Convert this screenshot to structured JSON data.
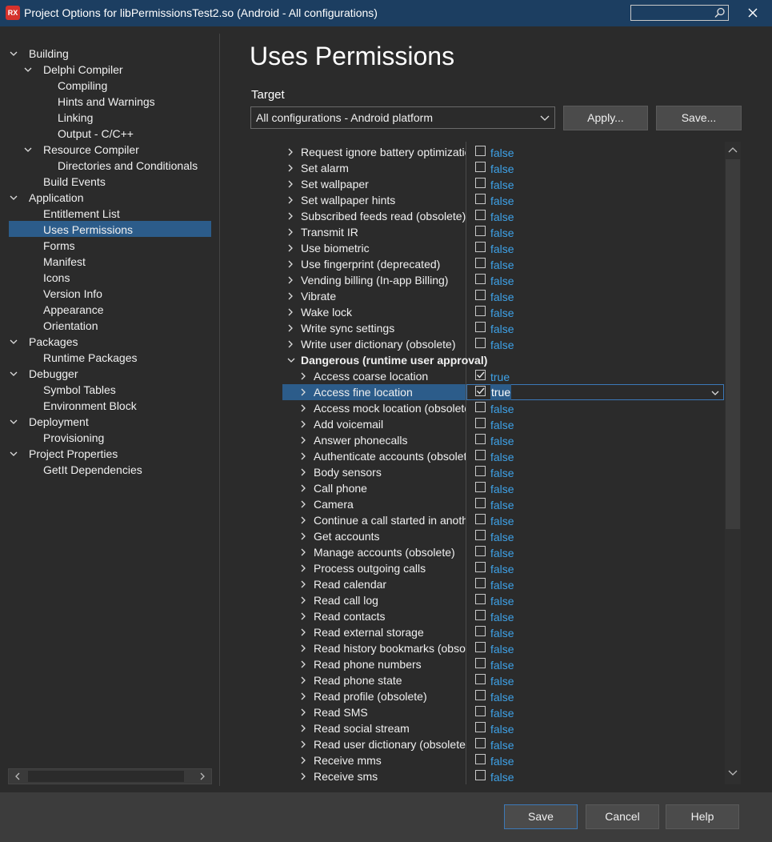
{
  "window": {
    "title": "Project Options for libPermissionsTest2.so  (Android - All configurations)",
    "logo_text": "RX",
    "search_placeholder": ""
  },
  "tree": [
    {
      "label": "Building",
      "level": 0,
      "expanded": true
    },
    {
      "label": "Delphi Compiler",
      "level": 1,
      "expanded": true
    },
    {
      "label": "Compiling",
      "level": 2
    },
    {
      "label": "Hints and Warnings",
      "level": 2
    },
    {
      "label": "Linking",
      "level": 2
    },
    {
      "label": "Output - C/C++",
      "level": 2
    },
    {
      "label": "Resource Compiler",
      "level": 1,
      "expanded": true
    },
    {
      "label": "Directories and Conditionals",
      "level": 2
    },
    {
      "label": "Build Events",
      "level": 1
    },
    {
      "label": "Application",
      "level": 0,
      "expanded": true
    },
    {
      "label": "Entitlement List",
      "level": 1
    },
    {
      "label": "Uses Permissions",
      "level": 1,
      "selected": true
    },
    {
      "label": "Forms",
      "level": 1
    },
    {
      "label": "Manifest",
      "level": 1
    },
    {
      "label": "Icons",
      "level": 1
    },
    {
      "label": "Version Info",
      "level": 1
    },
    {
      "label": "Appearance",
      "level": 1
    },
    {
      "label": "Orientation",
      "level": 1
    },
    {
      "label": "Packages",
      "level": 0,
      "expanded": true
    },
    {
      "label": "Runtime Packages",
      "level": 1
    },
    {
      "label": "Debugger",
      "level": 0,
      "expanded": true
    },
    {
      "label": "Symbol Tables",
      "level": 1
    },
    {
      "label": "Environment Block",
      "level": 1
    },
    {
      "label": "Deployment",
      "level": 0,
      "expanded": true
    },
    {
      "label": "Provisioning",
      "level": 1
    },
    {
      "label": "Project Properties",
      "level": 0,
      "expanded": true
    },
    {
      "label": "GetIt Dependencies",
      "level": 1
    }
  ],
  "main": {
    "title": "Uses Permissions",
    "target_label": "Target",
    "target_value": "All configurations - Android platform",
    "apply_label": "Apply...",
    "save_label": "Save..."
  },
  "permissions": [
    {
      "name": "Request ignore battery optimizations",
      "value": "false",
      "checked": false,
      "indent": 1
    },
    {
      "name": "Set alarm",
      "value": "false",
      "checked": false,
      "indent": 1
    },
    {
      "name": "Set wallpaper",
      "value": "false",
      "checked": false,
      "indent": 1
    },
    {
      "name": "Set wallpaper hints",
      "value": "false",
      "checked": false,
      "indent": 1
    },
    {
      "name": "Subscribed feeds read (obsolete)",
      "value": "false",
      "checked": false,
      "indent": 1
    },
    {
      "name": "Transmit IR",
      "value": "false",
      "checked": false,
      "indent": 1
    },
    {
      "name": "Use biometric",
      "value": "false",
      "checked": false,
      "indent": 1
    },
    {
      "name": "Use fingerprint (deprecated)",
      "value": "false",
      "checked": false,
      "indent": 1
    },
    {
      "name": "Vending billing (In-app Billing)",
      "value": "false",
      "checked": false,
      "indent": 1
    },
    {
      "name": "Vibrate",
      "value": "false",
      "checked": false,
      "indent": 1
    },
    {
      "name": "Wake lock",
      "value": "false",
      "checked": false,
      "indent": 1
    },
    {
      "name": "Write sync settings",
      "value": "false",
      "checked": false,
      "indent": 1
    },
    {
      "name": "Write user dictionary (obsolete)",
      "value": "false",
      "checked": false,
      "indent": 1
    },
    {
      "name": "Dangerous (runtime user approval)",
      "category": true
    },
    {
      "name": "Access coarse location",
      "value": "true",
      "checked": true,
      "indent": 2
    },
    {
      "name": "Access fine location",
      "value": "true",
      "checked": true,
      "indent": 2,
      "selected": true
    },
    {
      "name": "Access mock location (obsolete)",
      "value": "false",
      "checked": false,
      "indent": 2
    },
    {
      "name": "Add voicemail",
      "value": "false",
      "checked": false,
      "indent": 2
    },
    {
      "name": "Answer phonecalls",
      "value": "false",
      "checked": false,
      "indent": 2
    },
    {
      "name": "Authenticate accounts (obsolete)",
      "value": "false",
      "checked": false,
      "indent": 2
    },
    {
      "name": "Body sensors",
      "value": "false",
      "checked": false,
      "indent": 2
    },
    {
      "name": "Call phone",
      "value": "false",
      "checked": false,
      "indent": 2
    },
    {
      "name": "Camera",
      "value": "false",
      "checked": false,
      "indent": 2
    },
    {
      "name": "Continue a call started in another app",
      "value": "false",
      "checked": false,
      "indent": 2
    },
    {
      "name": "Get accounts",
      "value": "false",
      "checked": false,
      "indent": 2
    },
    {
      "name": "Manage accounts (obsolete)",
      "value": "false",
      "checked": false,
      "indent": 2
    },
    {
      "name": "Process outgoing calls",
      "value": "false",
      "checked": false,
      "indent": 2
    },
    {
      "name": "Read calendar",
      "value": "false",
      "checked": false,
      "indent": 2
    },
    {
      "name": "Read call log",
      "value": "false",
      "checked": false,
      "indent": 2
    },
    {
      "name": "Read contacts",
      "value": "false",
      "checked": false,
      "indent": 2
    },
    {
      "name": "Read external storage",
      "value": "false",
      "checked": false,
      "indent": 2
    },
    {
      "name": "Read history bookmarks (obsolete)",
      "value": "false",
      "checked": false,
      "indent": 2
    },
    {
      "name": "Read phone numbers",
      "value": "false",
      "checked": false,
      "indent": 2
    },
    {
      "name": "Read phone state",
      "value": "false",
      "checked": false,
      "indent": 2
    },
    {
      "name": "Read profile (obsolete)",
      "value": "false",
      "checked": false,
      "indent": 2
    },
    {
      "name": "Read SMS",
      "value": "false",
      "checked": false,
      "indent": 2
    },
    {
      "name": "Read social stream",
      "value": "false",
      "checked": false,
      "indent": 2
    },
    {
      "name": "Read user dictionary (obsolete)",
      "value": "false",
      "checked": false,
      "indent": 2
    },
    {
      "name": "Receive mms",
      "value": "false",
      "checked": false,
      "indent": 2
    },
    {
      "name": "Receive sms",
      "value": "false",
      "checked": false,
      "indent": 2
    }
  ],
  "footer": {
    "save_label": "Save",
    "cancel_label": "Cancel",
    "help_label": "Help"
  },
  "colors": {
    "titlebar": "#1c3e61",
    "selection": "#2c5c8a",
    "value_text": "#3ea2e8",
    "background": "#2b2b2b"
  }
}
